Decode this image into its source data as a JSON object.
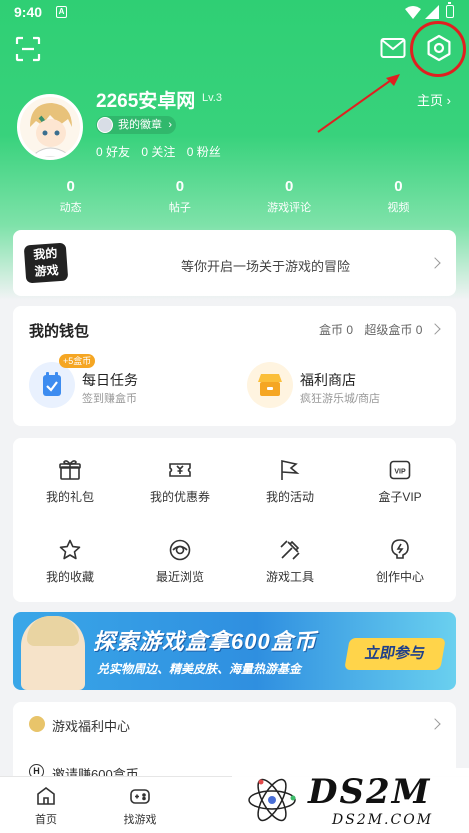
{
  "status_bar": {
    "time": "9:40",
    "sim_label": "A"
  },
  "profile": {
    "username": "2265安卓网",
    "level": "Lv.3",
    "homepage_link": "主页",
    "badge_label": "我的徽章",
    "friends": "0 好友",
    "following": "0 关注",
    "fans": "0 粉丝"
  },
  "stats": [
    {
      "value": "0",
      "label": "动态"
    },
    {
      "value": "0",
      "label": "帖子"
    },
    {
      "value": "0",
      "label": "游戏评论"
    },
    {
      "value": "0",
      "label": "视频"
    }
  ],
  "my_games": {
    "logo_line1": "我的",
    "logo_line2": "游戏",
    "tagline": "等你开启一场关于游戏的冒险"
  },
  "wallet": {
    "title": "我的钱包",
    "coins": "盒币 0",
    "super_coins": "超级盒币 0",
    "daily_task": {
      "reward_tag": "+5盒币",
      "name": "每日任务",
      "sub": "签到赚盒币"
    },
    "welfare_shop": {
      "name": "福利商店",
      "sub": "疯狂游乐城/商店"
    }
  },
  "tools": [
    {
      "label": "我的礼包",
      "icon": "gift-icon"
    },
    {
      "label": "我的优惠券",
      "icon": "coupon-icon"
    },
    {
      "label": "我的活动",
      "icon": "flag-icon"
    },
    {
      "label": "盒子VIP",
      "icon": "vip-icon"
    },
    {
      "label": "我的收藏",
      "icon": "star-icon"
    },
    {
      "label": "最近浏览",
      "icon": "eye-icon"
    },
    {
      "label": "游戏工具",
      "icon": "tools-icon"
    },
    {
      "label": "创作中心",
      "icon": "lightning-icon"
    }
  ],
  "banner": {
    "headline": "探索游戏盒拿600盒币",
    "subline": "兑实物周边、精美皮肤、海量热游基金",
    "cta": "立即参与"
  },
  "welfare_list": {
    "item1": "游戏福利中心",
    "item2": "邀请赚600盒币",
    "item2_icon_text": "H"
  },
  "bottom_nav": [
    {
      "label": "首页",
      "icon": "home-icon"
    },
    {
      "label": "找游戏",
      "icon": "gamepad-icon"
    }
  ],
  "watermark": {
    "main": "DS2M",
    "sub": "DS2M.COM"
  },
  "colors": {
    "brand_green": "#2fcf74",
    "highlight_red": "#e02020",
    "cta_yellow": "#ffd44a"
  }
}
